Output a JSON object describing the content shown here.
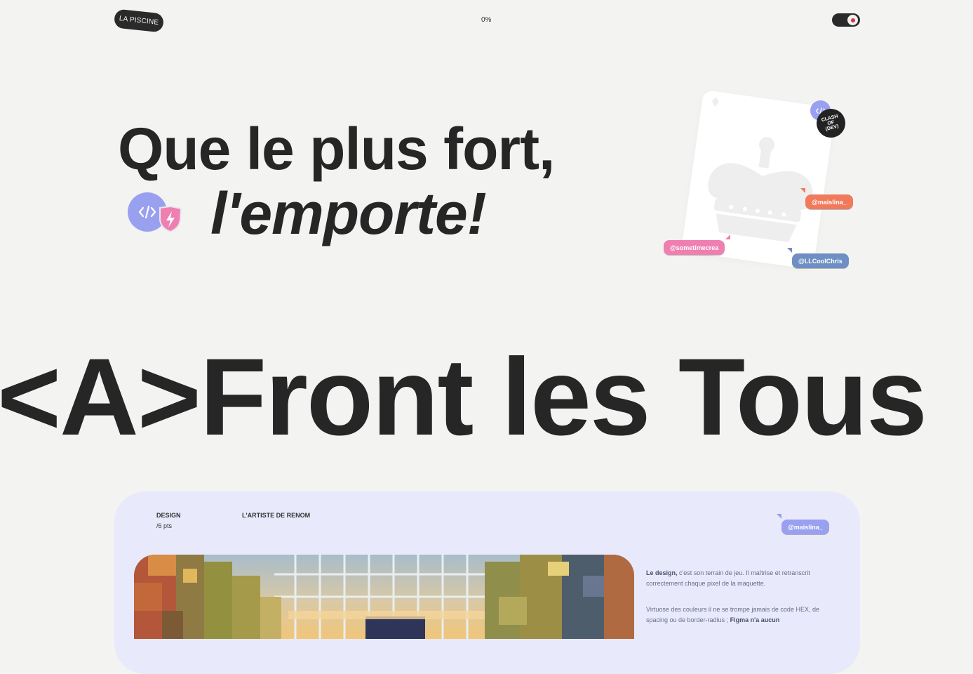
{
  "header": {
    "logo": "LA PISCINE",
    "progress": "0%",
    "theme_toggle": "dark-mode-toggle"
  },
  "hero": {
    "line1": "Que le plus fort,",
    "line2": "l'emporte!",
    "badge_icons": [
      "code-brackets-icon",
      "lightning-shield-icon"
    ]
  },
  "card": {
    "icon": "crown-icon",
    "clash_badge": "CLASH OF (DEV)",
    "tags": [
      {
        "label": "@maislina_",
        "color": "#f07a5a"
      },
      {
        "label": "@sometimecrea",
        "color": "#ee7fb0"
      },
      {
        "label": "@LLCoolChris",
        "color": "#6f8fc4"
      }
    ]
  },
  "marquee": {
    "text": "<A>Front les Tous"
  },
  "section": {
    "category": "DESIGN",
    "points": "/6 pts",
    "title": "L'ARTISTE DE RENOM",
    "tag": {
      "label": "@maislina_",
      "color": "#9aa0f0"
    },
    "paragraph1": {
      "bold": "Le design,",
      "text": " c'est son terrain de jeu. Il maîtrise et retranscrit correctement chaque pixel de la maquette."
    },
    "paragraph2": {
      "text": "Virtuose des couleurs il ne se trompe jamais de code HEX, de spacing ou de border-radius ; ",
      "bold": "Figma n'a aucun"
    }
  },
  "colors": {
    "background": "#f3f3f1",
    "text": "#262626",
    "section_bg": "#e8e9fb",
    "accent_purple": "#9aa0f0",
    "accent_pink": "#ee7fb0",
    "accent_orange": "#f07a5a",
    "accent_blue": "#6f8fc4"
  }
}
